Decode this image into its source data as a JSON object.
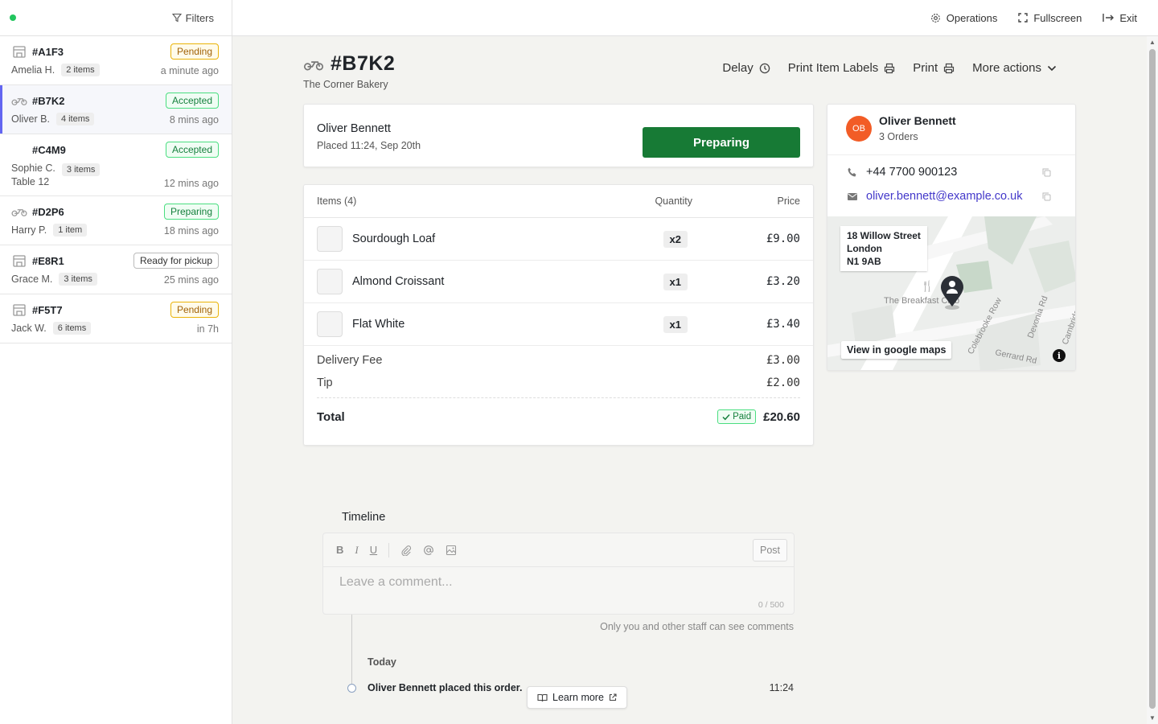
{
  "sidebar": {
    "filters_label": "Filters",
    "orders": [
      {
        "id": "#A1F3",
        "type": "pickup",
        "status": "Pending",
        "customer": "Amelia H.",
        "items": "2 items",
        "time": "a minute ago"
      },
      {
        "id": "#B7K2",
        "type": "delivery",
        "status": "Accepted",
        "customer": "Oliver B.",
        "items": "4 items",
        "time": "8 mins ago"
      },
      {
        "id": "#C4M9",
        "type": "dine-in",
        "status": "Accepted",
        "customer": "Sophie C.",
        "table": "Table 12",
        "items": "3 items",
        "time": "12 mins ago"
      },
      {
        "id": "#D2P6",
        "type": "delivery",
        "status": "Preparing",
        "customer": "Harry P.",
        "items": "1 item",
        "time": "18 mins ago"
      },
      {
        "id": "#E8R1",
        "type": "pickup",
        "status": "Ready for pickup",
        "customer": "Grace M.",
        "items": "3 items",
        "time": "25 mins ago"
      },
      {
        "id": "#F5T7",
        "type": "pickup",
        "status": "Pending",
        "customer": "Jack W.",
        "items": "6 items",
        "time": "in 7h"
      }
    ]
  },
  "topbar": {
    "operations": "Operations",
    "fullscreen": "Fullscreen",
    "exit": "Exit"
  },
  "order": {
    "id": "#B7K2",
    "store": "The Corner Bakery",
    "actions": {
      "delay": "Delay",
      "print_labels": "Print Item Labels",
      "print": "Print",
      "more": "More actions"
    },
    "customer_name": "Oliver Bennett",
    "placed": "Placed 11:24, Sep 20th",
    "status_button": "Preparing",
    "items_header": {
      "items": "Items",
      "count": "(4)",
      "quantity": "Quantity",
      "price": "Price"
    },
    "items": [
      {
        "name": "Sourdough Loaf",
        "qty": "x2",
        "price": "£9.00"
      },
      {
        "name": "Almond Croissant",
        "qty": "x1",
        "price": "£3.20"
      },
      {
        "name": "Flat White",
        "qty": "x1",
        "price": "£3.40"
      }
    ],
    "delivery_fee": {
      "label": "Delivery Fee",
      "value": "£3.00"
    },
    "tip": {
      "label": "Tip",
      "value": "£2.00"
    },
    "total": {
      "label": "Total",
      "paid": "Paid",
      "value": "£20.60"
    }
  },
  "contact": {
    "initials": "OB",
    "name": "Oliver Bennett",
    "orders": "3 Orders",
    "phone": "+44 7700 900123",
    "email": "oliver.bennett@example.co.uk",
    "address": {
      "line1": "18 Willow Street",
      "line2": "London",
      "line3": "N1 9AB"
    },
    "map_labels": {
      "poi": "The Breakfast Club",
      "road1": "Colebrooke Row",
      "road2": "Devonia Rd",
      "road3": "Gerrard Rd",
      "road4": "Cambridge"
    },
    "gmaps": "View in google maps",
    "info": "i"
  },
  "timeline": {
    "title": "Timeline",
    "tools": {
      "bold": "B",
      "italic": "I",
      "underline": "U"
    },
    "post": "Post",
    "placeholder": "Leave a comment...",
    "count": "0 / 500",
    "note": "Only you and other staff can see comments",
    "day": "Today",
    "event": "Oliver Bennett placed this order.",
    "event_time": "11:24",
    "learn_more": "Learn more"
  },
  "colors": {
    "accent": "#177a35",
    "avatar": "#f25c26",
    "link": "#4338ca"
  }
}
